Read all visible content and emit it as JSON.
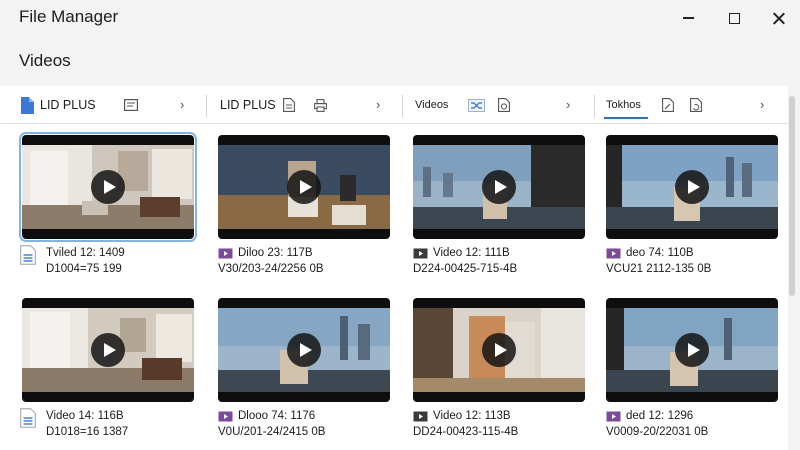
{
  "window": {
    "title": "File Manager",
    "heading": "Videos"
  },
  "tabs": [
    {
      "label": "LID PLUS",
      "icon": "document-icon",
      "secondary_icon": "list-icon"
    },
    {
      "label": "LID PLUS",
      "icon": "file-icon",
      "secondary_icon": "print-icon"
    },
    {
      "label": "Videos",
      "icon": "shuffle-icon",
      "secondary_icon": "file-clock-icon"
    },
    {
      "label": "Tokhos",
      "icon": "file-edit-icon",
      "secondary_icon": "file-refresh-icon",
      "active": true
    }
  ],
  "colors": {
    "accent": "#2f6fcc",
    "selection": "#7fb4e6",
    "doc_blue": "#3b78d8",
    "video_purple": "#7a4a9b"
  },
  "files": [
    {
      "line1": "Tviled 12: 1409",
      "line2": "D1004=75 199",
      "icon": "document-icon"
    },
    {
      "line1": "Diloo 23: 117B",
      "line2": "V30/203-24/2256 0B",
      "icon": "video-file-icon"
    },
    {
      "line1": "Video 12: 111B",
      "line2": "D224-00425-715-4B",
      "icon": "video-file-icon"
    },
    {
      "line1": "deo 74: 110B",
      "line2": "VCU21 2112-135 0B",
      "icon": "video-file-icon"
    },
    {
      "line1": "Video 14: 116B",
      "line2": "D1018=16 1387",
      "icon": "document-icon"
    },
    {
      "line1": "Dlooo 74: 1176",
      "line2": "V0U/201-24/2415 0B",
      "icon": "video-file-icon"
    },
    {
      "line1": "Video 12: 113B",
      "line2": "DD24-00423-115-4B",
      "icon": "video-file-icon"
    },
    {
      "line1": "ded 12: 1296",
      "line2": "V0009-20/22031 0B",
      "icon": "video-file-icon"
    }
  ]
}
